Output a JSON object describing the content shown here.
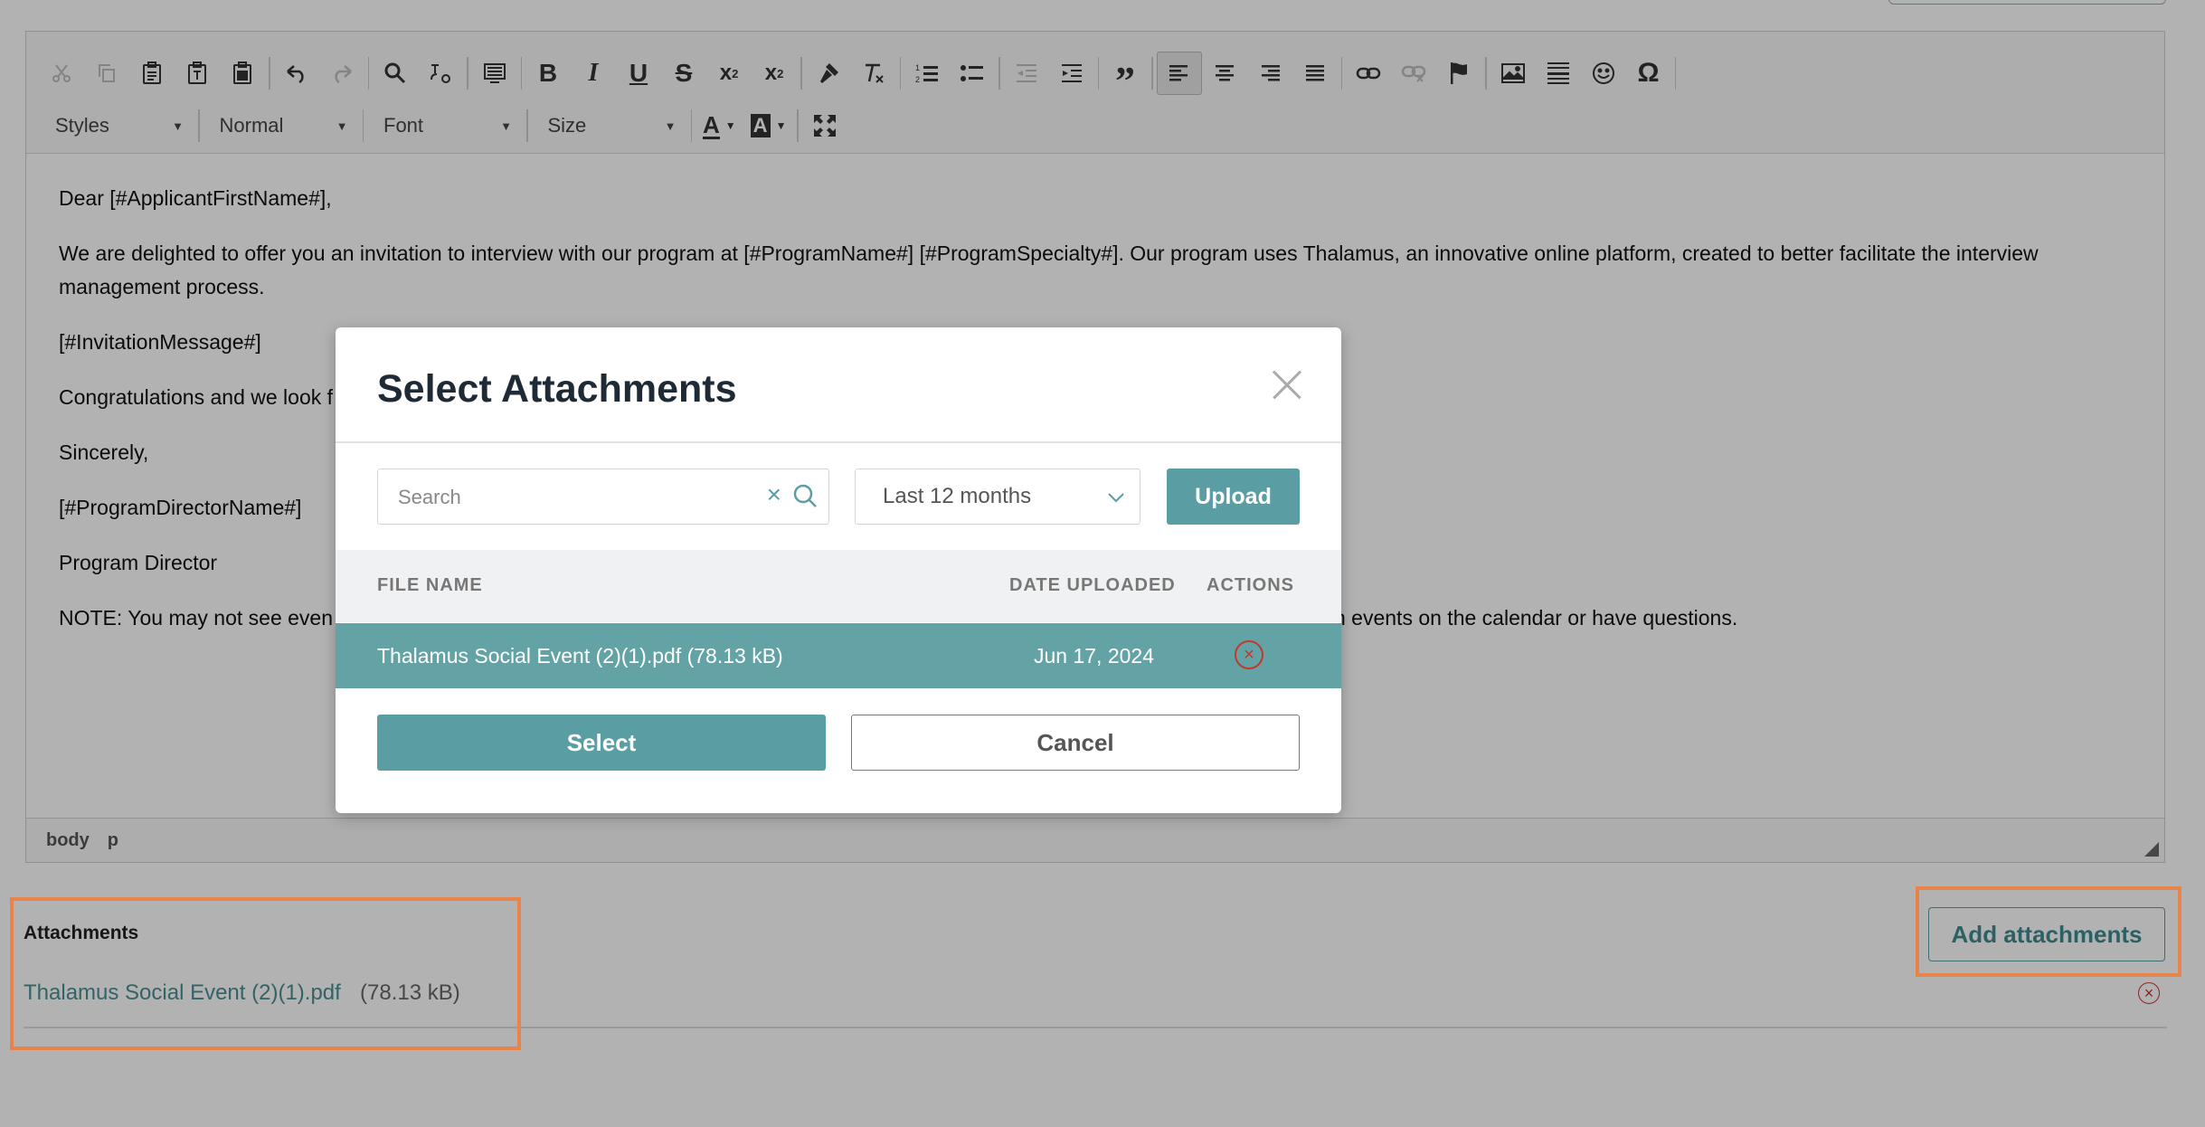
{
  "editor": {
    "toolbar_row1": [
      "cut-icon",
      "copy-icon",
      "paste-icon",
      "paste-text-icon",
      "paste-word-icon",
      "undo-icon",
      "redo-icon",
      "find-icon",
      "replace-icon",
      "select-all-icon",
      "bold-icon",
      "italic-icon",
      "underline-icon",
      "strikethrough-icon",
      "subscript-icon",
      "superscript-icon",
      "copy-format-icon",
      "remove-format-icon",
      "numbered-list-icon",
      "bulleted-list-icon",
      "decrease-indent-icon",
      "increase-indent-icon",
      "blockquote-icon",
      "align-left-icon",
      "align-center-icon",
      "align-right-icon",
      "justify-icon",
      "link-icon",
      "unlink-icon",
      "anchor-icon",
      "image-icon",
      "horizontal-line-icon",
      "smiley-icon",
      "special-char-icon"
    ],
    "styles_label": "Styles",
    "format_label": "Normal",
    "font_label": "Font",
    "size_label": "Size",
    "text_color_glyph": "A",
    "bg_color_glyph": "A",
    "content": {
      "p1": "Dear [#ApplicantFirstName#],",
      "p2": "We are delighted to offer you an invitation to interview with our program at [#ProgramName#] [#ProgramSpecialty#]. Our program uses Thalamus, an innovative online platform, created to better facilitate the interview management process.",
      "p3": "[#InvitationMessage#]",
      "p4": "Congratulations and we look f",
      "p5": "Sincerely,",
      "p6": "[#ProgramDirectorName#]",
      "p7": "Program Director",
      "p8_start": "NOTE: You may not see even",
      "p8_end": "n events on the calendar or have questions."
    },
    "status_body": "body",
    "status_p": "p"
  },
  "attachments": {
    "title": "Attachments",
    "file_name": "Thalamus Social Event (2)(1).pdf",
    "file_size": "(78.13 kB)",
    "remove_glyph": "×",
    "add_button": "Add attachments"
  },
  "modal": {
    "title": "Select Attachments",
    "search_placeholder": "Search",
    "search_clear_glyph": "×",
    "date_filter": "Last 12 months",
    "upload_label": "Upload",
    "columns": {
      "file_name": "FILE NAME",
      "date_uploaded": "DATE UPLOADED",
      "actions": "ACTIONS"
    },
    "rows": [
      {
        "file": "Thalamus Social Event (2)(1).pdf (78.13 kB)",
        "date": "Jun 17, 2024",
        "remove_glyph": "×"
      }
    ],
    "select_label": "Select",
    "cancel_label": "Cancel"
  },
  "colors": {
    "accent": "#5a9ea3",
    "selected_row": "#64a3a5",
    "highlight": "#e8834a",
    "danger": "#c0392b"
  }
}
